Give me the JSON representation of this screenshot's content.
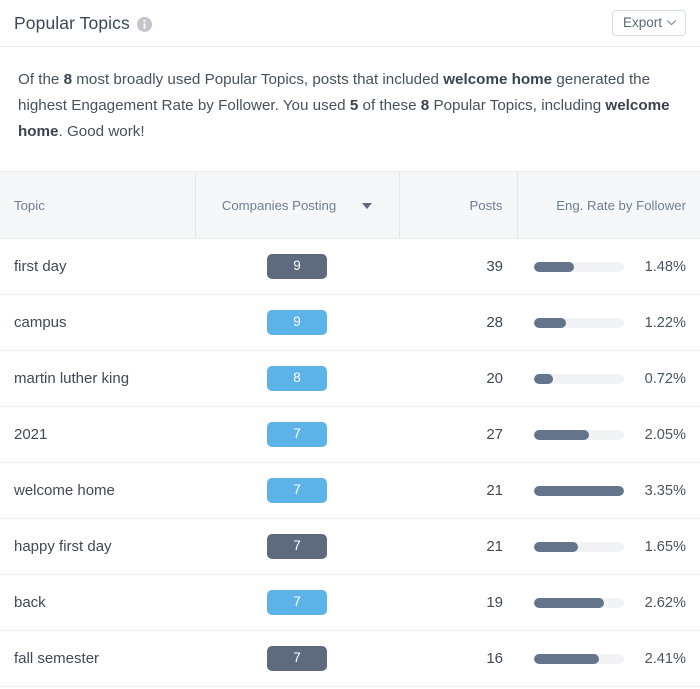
{
  "header": {
    "title": "Popular Topics",
    "info_icon": "info-icon",
    "export_label": "Export"
  },
  "description": {
    "part1": "Of the ",
    "bold1": "8",
    "part2": " most broadly used Popular Topics, posts that included ",
    "bold2": "welcome home",
    "part3": " generated the highest Engagement Rate by Follower. You used ",
    "bold3": "5",
    "part4": " of these ",
    "bold4": "8",
    "part5": " Popular Topics, including ",
    "bold5": "welcome home",
    "part6": ". Good work!"
  },
  "table": {
    "columns": [
      {
        "key": "topic",
        "label": "Topic"
      },
      {
        "key": "companies_posting",
        "label": "Companies Posting",
        "sorted": "desc"
      },
      {
        "key": "posts",
        "label": "Posts"
      },
      {
        "key": "eng_rate",
        "label": "Eng. Rate by Follower"
      }
    ],
    "colors": {
      "badge_used": "#5bb3e8",
      "badge_unused": "#5e6b7e",
      "bar_fill": "#64748b",
      "bar_track": "#f1f3f5"
    },
    "rows": [
      {
        "topic": "first day",
        "companies_posting": "9",
        "badge_color": "#5e6b7e",
        "posts": "39",
        "eng_rate": "1.48%",
        "bar_pct": 44
      },
      {
        "topic": "campus",
        "companies_posting": "9",
        "badge_color": "#5bb3e8",
        "posts": "28",
        "eng_rate": "1.22%",
        "bar_pct": 36
      },
      {
        "topic": "martin luther king",
        "companies_posting": "8",
        "badge_color": "#5bb3e8",
        "posts": "20",
        "eng_rate": "0.72%",
        "bar_pct": 21
      },
      {
        "topic": "2021",
        "companies_posting": "7",
        "badge_color": "#5bb3e8",
        "posts": "27",
        "eng_rate": "2.05%",
        "bar_pct": 61
      },
      {
        "topic": "welcome home",
        "companies_posting": "7",
        "badge_color": "#5bb3e8",
        "posts": "21",
        "eng_rate": "3.35%",
        "bar_pct": 100
      },
      {
        "topic": "happy first day",
        "companies_posting": "7",
        "badge_color": "#5e6b7e",
        "posts": "21",
        "eng_rate": "1.65%",
        "bar_pct": 49
      },
      {
        "topic": "back",
        "companies_posting": "7",
        "badge_color": "#5bb3e8",
        "posts": "19",
        "eng_rate": "2.62%",
        "bar_pct": 78
      },
      {
        "topic": "fall semester",
        "companies_posting": "7",
        "badge_color": "#5e6b7e",
        "posts": "16",
        "eng_rate": "2.41%",
        "bar_pct": 72
      }
    ]
  },
  "chart_data": {
    "type": "table",
    "title": "Popular Topics",
    "categories": [
      "first day",
      "campus",
      "martin luther king",
      "2021",
      "welcome home",
      "happy first day",
      "back",
      "fall semester"
    ],
    "series": [
      {
        "name": "Companies Posting",
        "values": [
          9,
          9,
          8,
          7,
          7,
          7,
          7,
          7
        ]
      },
      {
        "name": "Posts",
        "values": [
          39,
          28,
          20,
          27,
          21,
          21,
          19,
          16
        ]
      },
      {
        "name": "Eng. Rate by Follower",
        "values": [
          1.48,
          1.22,
          0.72,
          2.05,
          3.35,
          1.65,
          2.62,
          2.41
        ],
        "unit": "%"
      }
    ],
    "xlabel": "Topic",
    "ylabel": "",
    "ylim": [
      0,
      3.35
    ],
    "legend": "none",
    "grid": false
  }
}
